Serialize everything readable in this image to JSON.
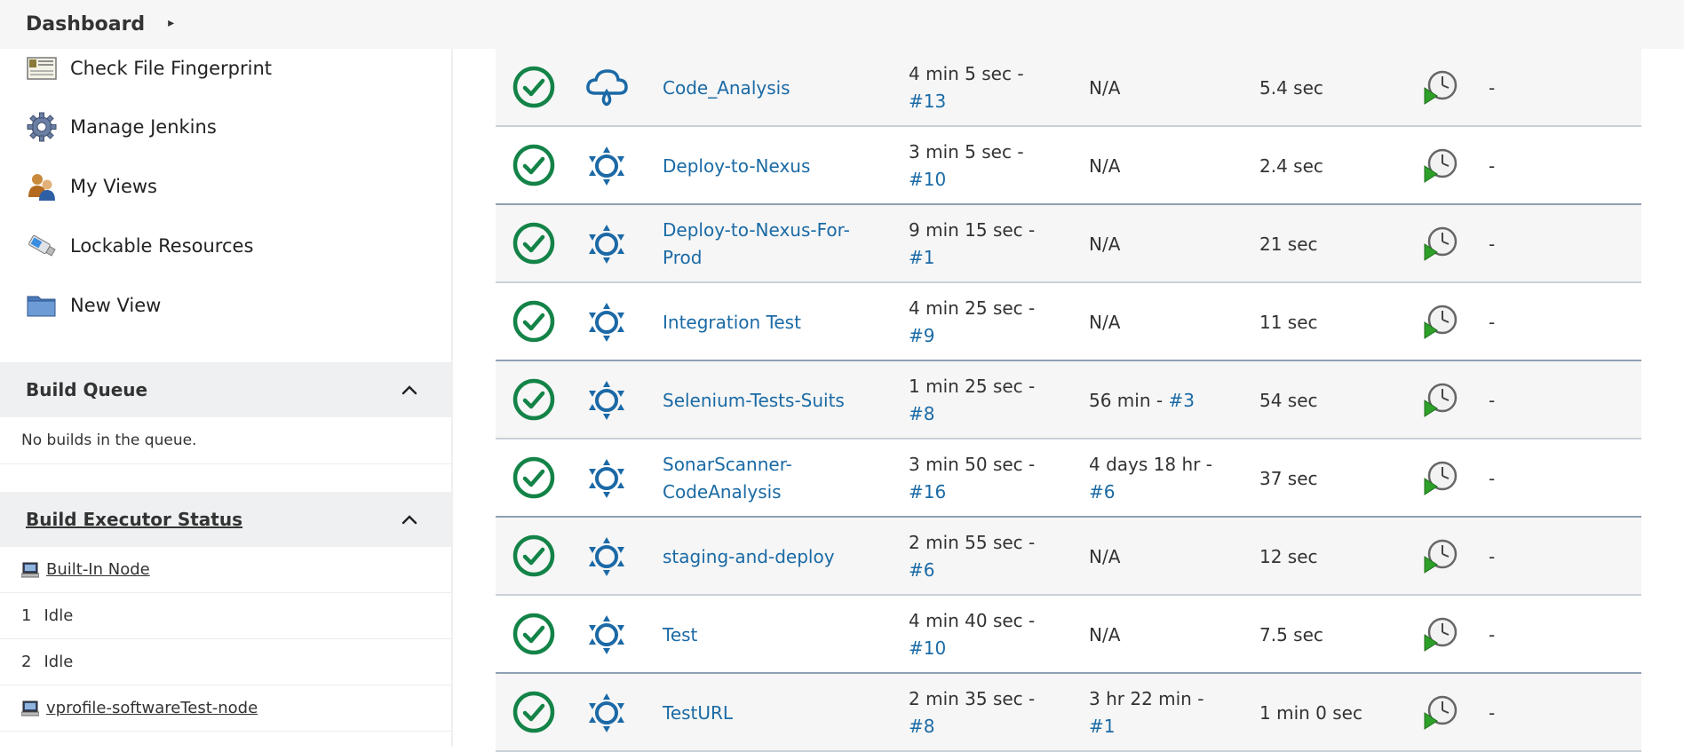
{
  "header": {
    "breadcrumb": "Dashboard"
  },
  "sidebar": {
    "tasks": [
      {
        "label": "Check File Fingerprint",
        "icon": "fingerprint-icon"
      },
      {
        "label": "Manage Jenkins",
        "icon": "gear-icon"
      },
      {
        "label": "My Views",
        "icon": "users-icon"
      },
      {
        "label": "Lockable Resources",
        "icon": "usb-icon"
      },
      {
        "label": "New View",
        "icon": "folder-icon"
      }
    ],
    "build_queue": {
      "title": "Build Queue",
      "empty_text": "No builds in the queue."
    },
    "executor_status": {
      "title": "Build Executor Status",
      "nodes": [
        {
          "name": "Built-In Node",
          "executors": [
            {
              "num": "1",
              "state": "Idle"
            },
            {
              "num": "2",
              "state": "Idle"
            }
          ]
        },
        {
          "name": "vprofile-softwareTest-node"
        }
      ]
    }
  },
  "jobs": [
    {
      "name": "Code_Analysis",
      "name2": "",
      "weather": "cloud-rain-icon",
      "last_success": "4 min 5 sec -",
      "last_success_build": "#13",
      "last_failure": "N/A",
      "last_failure_build": "",
      "last_duration": "5.4 sec",
      "description": "-"
    },
    {
      "name": "Deploy-to-Nexus",
      "name2": "",
      "weather": "sun-icon",
      "last_success": "3 min 5 sec -",
      "last_success_build": "#10",
      "last_failure": "N/A",
      "last_failure_build": "",
      "last_duration": "2.4 sec",
      "description": "-"
    },
    {
      "name": "Deploy-to-Nexus-For-",
      "name2": "Prod",
      "weather": "sun-icon",
      "last_success": "9 min 15 sec -",
      "last_success_build": "#1",
      "last_failure": "N/A",
      "last_failure_build": "",
      "last_duration": "21 sec",
      "description": "-"
    },
    {
      "name": "Integration Test",
      "name2": "",
      "weather": "sun-icon",
      "last_success": "4 min 25 sec -",
      "last_success_build": "#9",
      "last_failure": "N/A",
      "last_failure_build": "",
      "last_duration": "11 sec",
      "description": "-"
    },
    {
      "name": "Selenium-Tests-Suits",
      "name2": "",
      "weather": "sun-icon",
      "last_success": "1 min 25 sec -",
      "last_success_build": "#8",
      "last_failure": "56 min - ",
      "last_failure_build": "#3",
      "last_duration": "54 sec",
      "description": "-"
    },
    {
      "name": "SonarScanner-",
      "name2": "CodeAnalysis",
      "weather": "sun-icon",
      "last_success": "3 min 50 sec -",
      "last_success_build": "#16",
      "last_failure": "4 days 18 hr -",
      "last_failure_build": "#6",
      "last_duration": "37 sec",
      "description": "-"
    },
    {
      "name": "staging-and-deploy",
      "name2": "",
      "weather": "sun-icon",
      "last_success": "2 min 55 sec -",
      "last_success_build": "#6",
      "last_failure": "N/A",
      "last_failure_build": "",
      "last_duration": "12 sec",
      "description": "-"
    },
    {
      "name": "Test",
      "name2": "",
      "weather": "sun-icon",
      "last_success": "4 min 40 sec -",
      "last_success_build": "#10",
      "last_failure": "N/A",
      "last_failure_build": "",
      "last_duration": "7.5 sec",
      "description": "-"
    },
    {
      "name": "TestURL",
      "name2": "",
      "weather": "sun-icon",
      "last_success": "2 min 35 sec -",
      "last_success_build": "#8",
      "last_failure": "3 hr 22 min -",
      "last_failure_build": "#1",
      "last_duration": "1 min 0 sec",
      "description": "-"
    }
  ],
  "colors": {
    "success": "#138347",
    "link": "#1a6aa5",
    "weather": "#1b69a6"
  }
}
